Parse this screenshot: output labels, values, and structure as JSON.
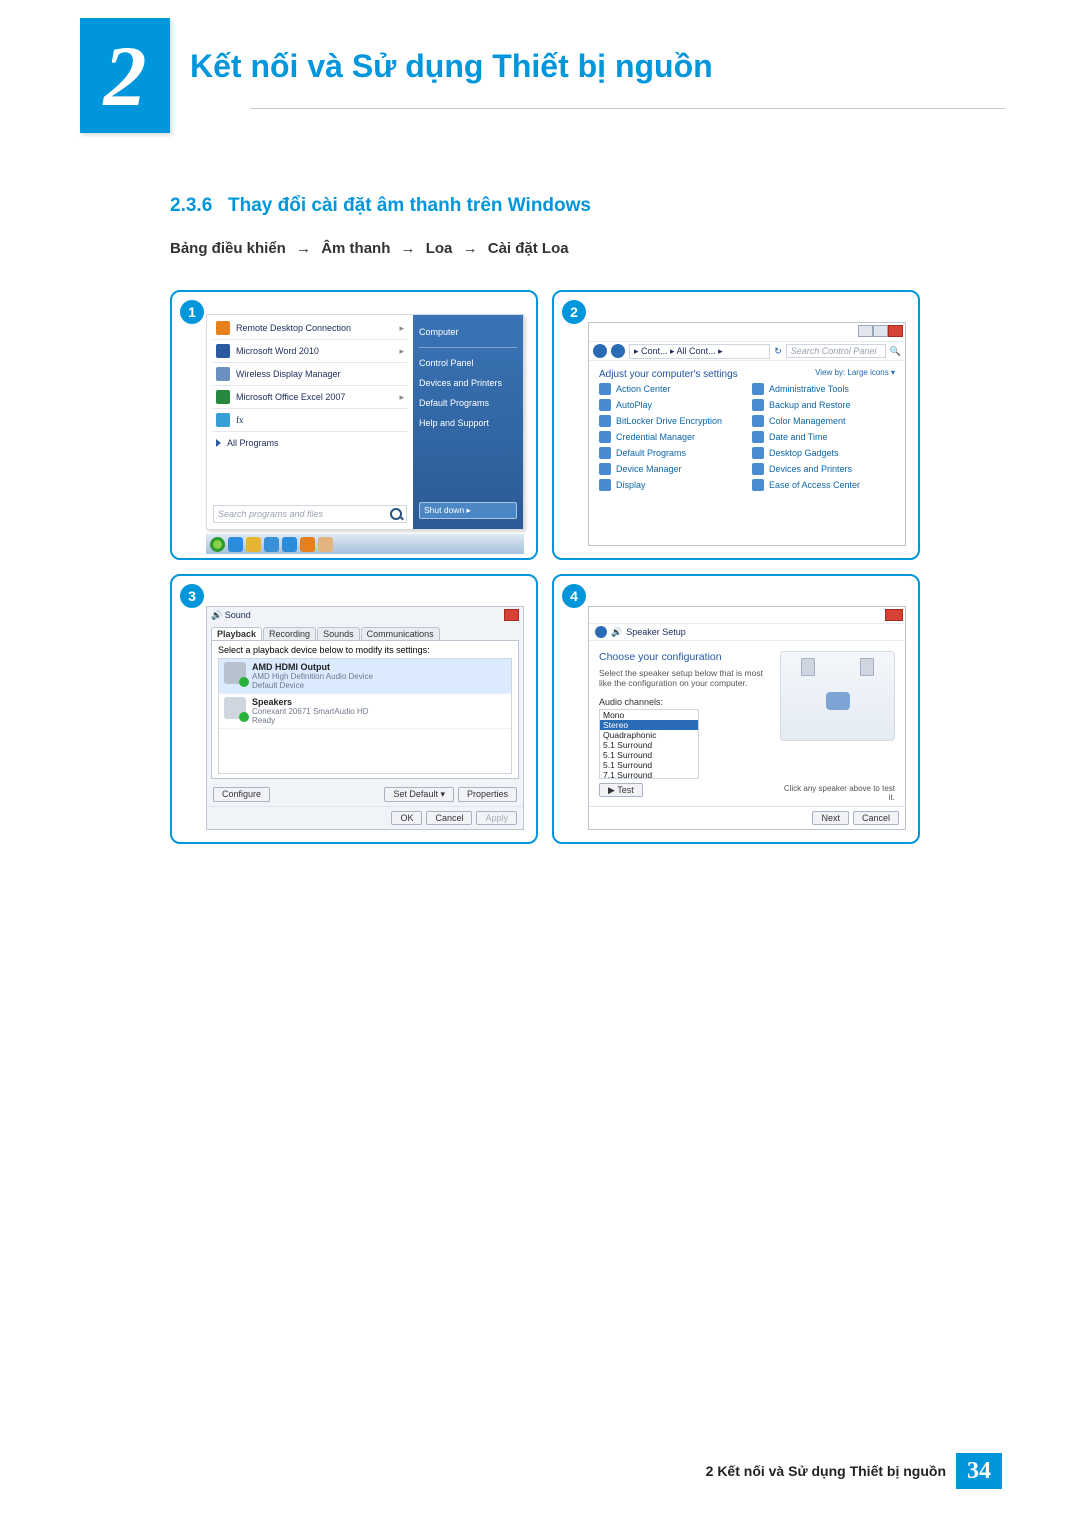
{
  "chapter": {
    "number": "2",
    "title": "Kết nối và Sử dụng Thiết bị nguồn"
  },
  "section": {
    "number": "2.3.6",
    "title": "Thay đổi cài đặt âm thanh trên Windows"
  },
  "breadcrumb": {
    "a": "Bảng điều khiển",
    "b": "Âm thanh",
    "c": "Loa",
    "d": "Cài đặt Loa",
    "arrow": "→"
  },
  "steps": {
    "s1": "1",
    "s2": "2",
    "s3": "3",
    "s4": "4"
  },
  "start_menu": {
    "items": [
      "Remote Desktop Connection",
      "Microsoft Word 2010",
      "Wireless Display Manager",
      "Microsoft Office Excel 2007",
      "fx"
    ],
    "all_programs": "All Programs",
    "search_placeholder": "Search programs and files",
    "right": {
      "computer": "Computer",
      "control_panel": "Control Panel",
      "devices": "Devices and Printers",
      "defaults": "Default Programs",
      "help": "Help and Support",
      "shutdown": "Shut down"
    }
  },
  "control_panel": {
    "breadcrumb": "▸ Cont... ▸ All Cont...  ▸",
    "search_placeholder": "Search Control Panel",
    "heading": "Adjust your computer's settings",
    "view": "View by:   Large icons ▾",
    "items_left": [
      "Action Center",
      "AutoPlay",
      "BitLocker Drive Encryption",
      "Credential Manager",
      "Default Programs",
      "Device Manager",
      "Display"
    ],
    "items_right": [
      "Administrative Tools",
      "Backup and Restore",
      "Color Management",
      "Date and Time",
      "Desktop Gadgets",
      "Devices and Printers",
      "Ease of Access Center"
    ]
  },
  "sound": {
    "title": "Sound",
    "tabs": [
      "Playback",
      "Recording",
      "Sounds",
      "Communications"
    ],
    "instruct": "Select a playback device below to modify its settings:",
    "devices": [
      {
        "l1": "AMD HDMI Output",
        "l2a": "AMD High Definition Audio Device",
        "l2b": "Default Device"
      },
      {
        "l1": "Speakers",
        "l2a": "Conexant 20671 SmartAudio HD",
        "l2b": "Ready"
      }
    ],
    "buttons": {
      "configure": "Configure",
      "setdefault": "Set Default  ▾",
      "properties": "Properties",
      "ok": "OK",
      "cancel": "Cancel",
      "apply": "Apply"
    }
  },
  "speaker_setup": {
    "title": "Speaker Setup",
    "header": "Choose your configuration",
    "hint": "Select the speaker setup below that is most like the configuration on your computer.",
    "label": "Audio channels:",
    "options": [
      "Mono",
      "Stereo",
      "Quadraphonic",
      "5.1 Surround",
      "5.1 Surround",
      "5.1 Surround",
      "7.1 Surround"
    ],
    "test": "▶ Test",
    "note": "Click any speaker above to test it.",
    "next": "Next",
    "cancel": "Cancel"
  },
  "footer": {
    "text": "2 Kết nối và Sử dụng Thiết bị nguồn",
    "page": "34"
  }
}
